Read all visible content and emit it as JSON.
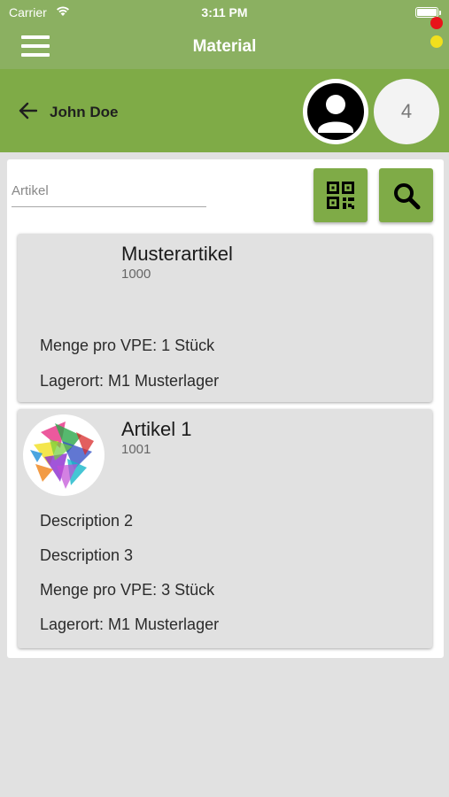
{
  "status_bar": {
    "carrier": "Carrier",
    "time": "3:11 PM"
  },
  "header": {
    "title": "Material",
    "menu_icon": "hamburger-menu-icon"
  },
  "user_bar": {
    "back_icon": "arrow-left-icon",
    "user_name": "John Doe",
    "avatar_icon": "account-circle-icon",
    "count": "4",
    "indicator_colors": [
      "#e8141a",
      "#f1df1d"
    ]
  },
  "search": {
    "placeholder": "Artikel",
    "value": "",
    "qr_icon": "qr-code-icon",
    "search_icon": "search-icon"
  },
  "items": [
    {
      "name": "Musterartikel",
      "number": "1000",
      "details": [
        "Menge pro VPE: 1 Stück",
        "Lagerort: M1 Musterlager"
      ]
    },
    {
      "name": "Artikel 1",
      "number": "1001",
      "details": [
        "Description 2",
        "Description 3",
        "Menge pro VPE: 3 Stück",
        "Lagerort: M1 Musterlager"
      ]
    }
  ],
  "colors": {
    "accent": "#7fab47",
    "header": "#8bb061",
    "background": "#e1e1e1"
  }
}
